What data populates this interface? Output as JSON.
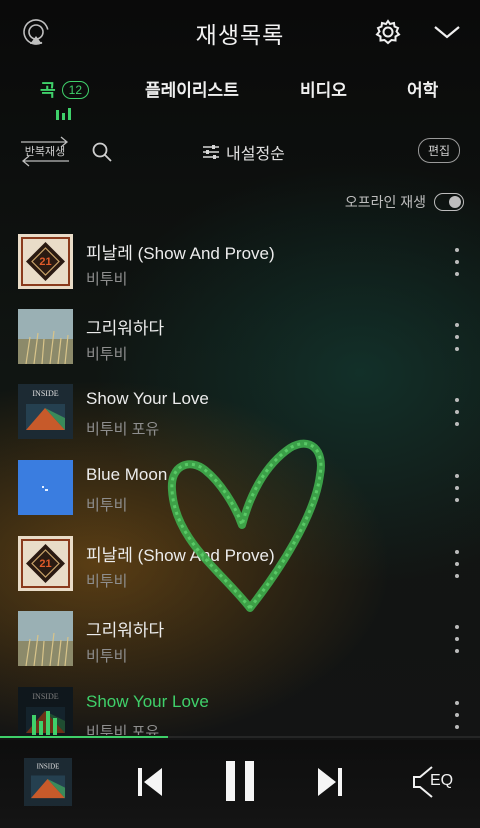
{
  "header": {
    "title": "재생목록",
    "left_icon": "cast-icon",
    "settings_icon": "gear-icon",
    "collapse_icon": "chevron-down-icon"
  },
  "tabs": [
    {
      "label": "곡",
      "count": "12",
      "active": true
    },
    {
      "label": "플레이리스트"
    },
    {
      "label": "비디오"
    },
    {
      "label": "어학"
    }
  ],
  "toolbar": {
    "repeat_label": "반복재생",
    "sort_label": "내설정순",
    "edit_label": "편집"
  },
  "offline": {
    "label": "오프라인 재생",
    "enabled": false
  },
  "songs": [
    {
      "title": "피날레 (Show And Prove)",
      "artist": "비투비",
      "art": "finale"
    },
    {
      "title": "그리워하다",
      "artist": "비투비",
      "art": "field"
    },
    {
      "title": "Show Your Love",
      "artist": "비투비 포유",
      "art": "inside"
    },
    {
      "title": "Blue Moon",
      "artist": "비투비",
      "art": "blue"
    },
    {
      "title": "피날레 (Show And Prove)",
      "artist": "비투비",
      "art": "finale"
    },
    {
      "title": "그리워하다",
      "artist": "비투비",
      "art": "field"
    },
    {
      "title": "Show Your Love",
      "artist": "비투비 포유",
      "art": "inside",
      "playing": true
    }
  ],
  "player": {
    "progress": 0.35,
    "eq_label": "EQ",
    "accent": "#3fd06a"
  }
}
